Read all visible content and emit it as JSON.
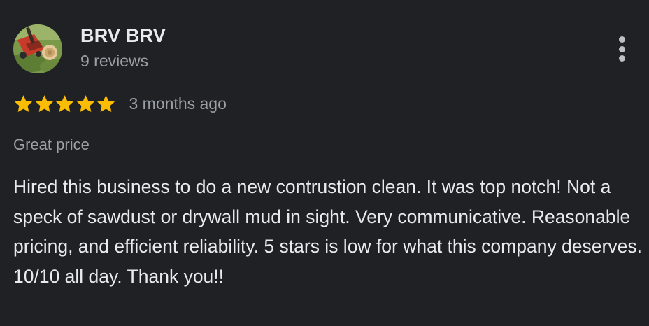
{
  "reviewer": {
    "name": "BRV BRV",
    "review_count": "9 reviews",
    "avatar_icon": "lawn-mowing-photo"
  },
  "menu": {
    "icon": "more-vert-icon"
  },
  "rating": {
    "stars": 5,
    "max_stars": 5,
    "star_color": "#fbbc04",
    "date": "3 months ago"
  },
  "review": {
    "subtitle": "Great price",
    "text": "Hired this business to do a new contrustion clean. It was top notch! Not a speck of sawdust or drywall mud in sight. Very communicative. Reasonable pricing, and efficient reliability. 5 stars is low for what this company deserves. 10/10 all day. Thank you!!"
  },
  "colors": {
    "background": "#202124",
    "primary_text": "#e8eaed",
    "secondary_text": "#9aa0a6"
  }
}
